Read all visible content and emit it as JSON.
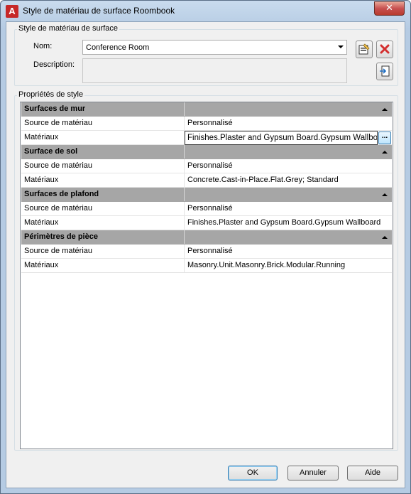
{
  "window": {
    "title": "Style de matériau de surface Roombook",
    "close_glyph": "✕"
  },
  "style_group": {
    "label": "Style de matériau de surface",
    "name_label": "Nom:",
    "name_value": "Conference Room",
    "description_label": "Description:",
    "description_value": ""
  },
  "properties_group": {
    "label": "Propriétés de style",
    "sections": [
      {
        "title": "Surfaces de mur",
        "rows": [
          {
            "label": "Source de matériau",
            "value": "Personnalisé"
          },
          {
            "label": "Matériaux",
            "value": "Finishes.Plaster and Gypsum Board.Gypsum Wallboard",
            "editing": true
          }
        ]
      },
      {
        "title": "Surface de sol",
        "rows": [
          {
            "label": "Source de matériau",
            "value": "Personnalisé"
          },
          {
            "label": "Matériaux",
            "value": "Concrete.Cast-in-Place.Flat.Grey; Standard"
          }
        ]
      },
      {
        "title": "Surfaces de plafond",
        "rows": [
          {
            "label": "Source de matériau",
            "value": "Personnalisé"
          },
          {
            "label": "Matériaux",
            "value": "Finishes.Plaster and Gypsum Board.Gypsum Wallboard"
          }
        ]
      },
      {
        "title": "Périmètres de pièce",
        "rows": [
          {
            "label": "Source de matériau",
            "value": "Personnalisé"
          },
          {
            "label": "Matériaux",
            "value": "Masonry.Unit.Masonry.Brick.Modular.Running"
          }
        ]
      }
    ],
    "ellipsis_label": "..."
  },
  "buttons": {
    "ok": "OK",
    "cancel": "Annuler",
    "help": "Aide"
  },
  "icons": {
    "app": "autocad-app-icon",
    "new_style": "new-style-icon",
    "delete": "delete-icon",
    "import": "import-style-icon"
  },
  "colors": {
    "section_header": "#a6a6a6",
    "delete_red": "#d32f2f"
  }
}
